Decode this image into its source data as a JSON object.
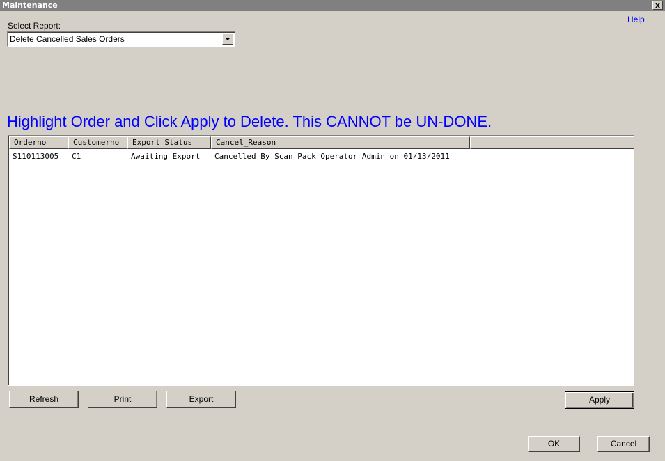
{
  "window": {
    "title": "Maintenance",
    "close_label": "x"
  },
  "help": {
    "label": "Help"
  },
  "report": {
    "label": "Select Report:",
    "selected": "Delete Cancelled Sales Orders"
  },
  "instruction": "Highlight Order and Click Apply to Delete.  This CANNOT be UN-DONE.",
  "table": {
    "columns": [
      "Orderno",
      "Customerno",
      "Export Status",
      "Cancel_Reason"
    ],
    "rows": [
      [
        "S110113005",
        "C1",
        "Awaiting Export",
        "Cancelled By Scan Pack Operator Admin on 01/13/2011"
      ]
    ]
  },
  "buttons": {
    "refresh": "Refresh",
    "print": "Print",
    "export": "Export",
    "apply": "Apply",
    "ok": "OK",
    "cancel": "Cancel"
  }
}
